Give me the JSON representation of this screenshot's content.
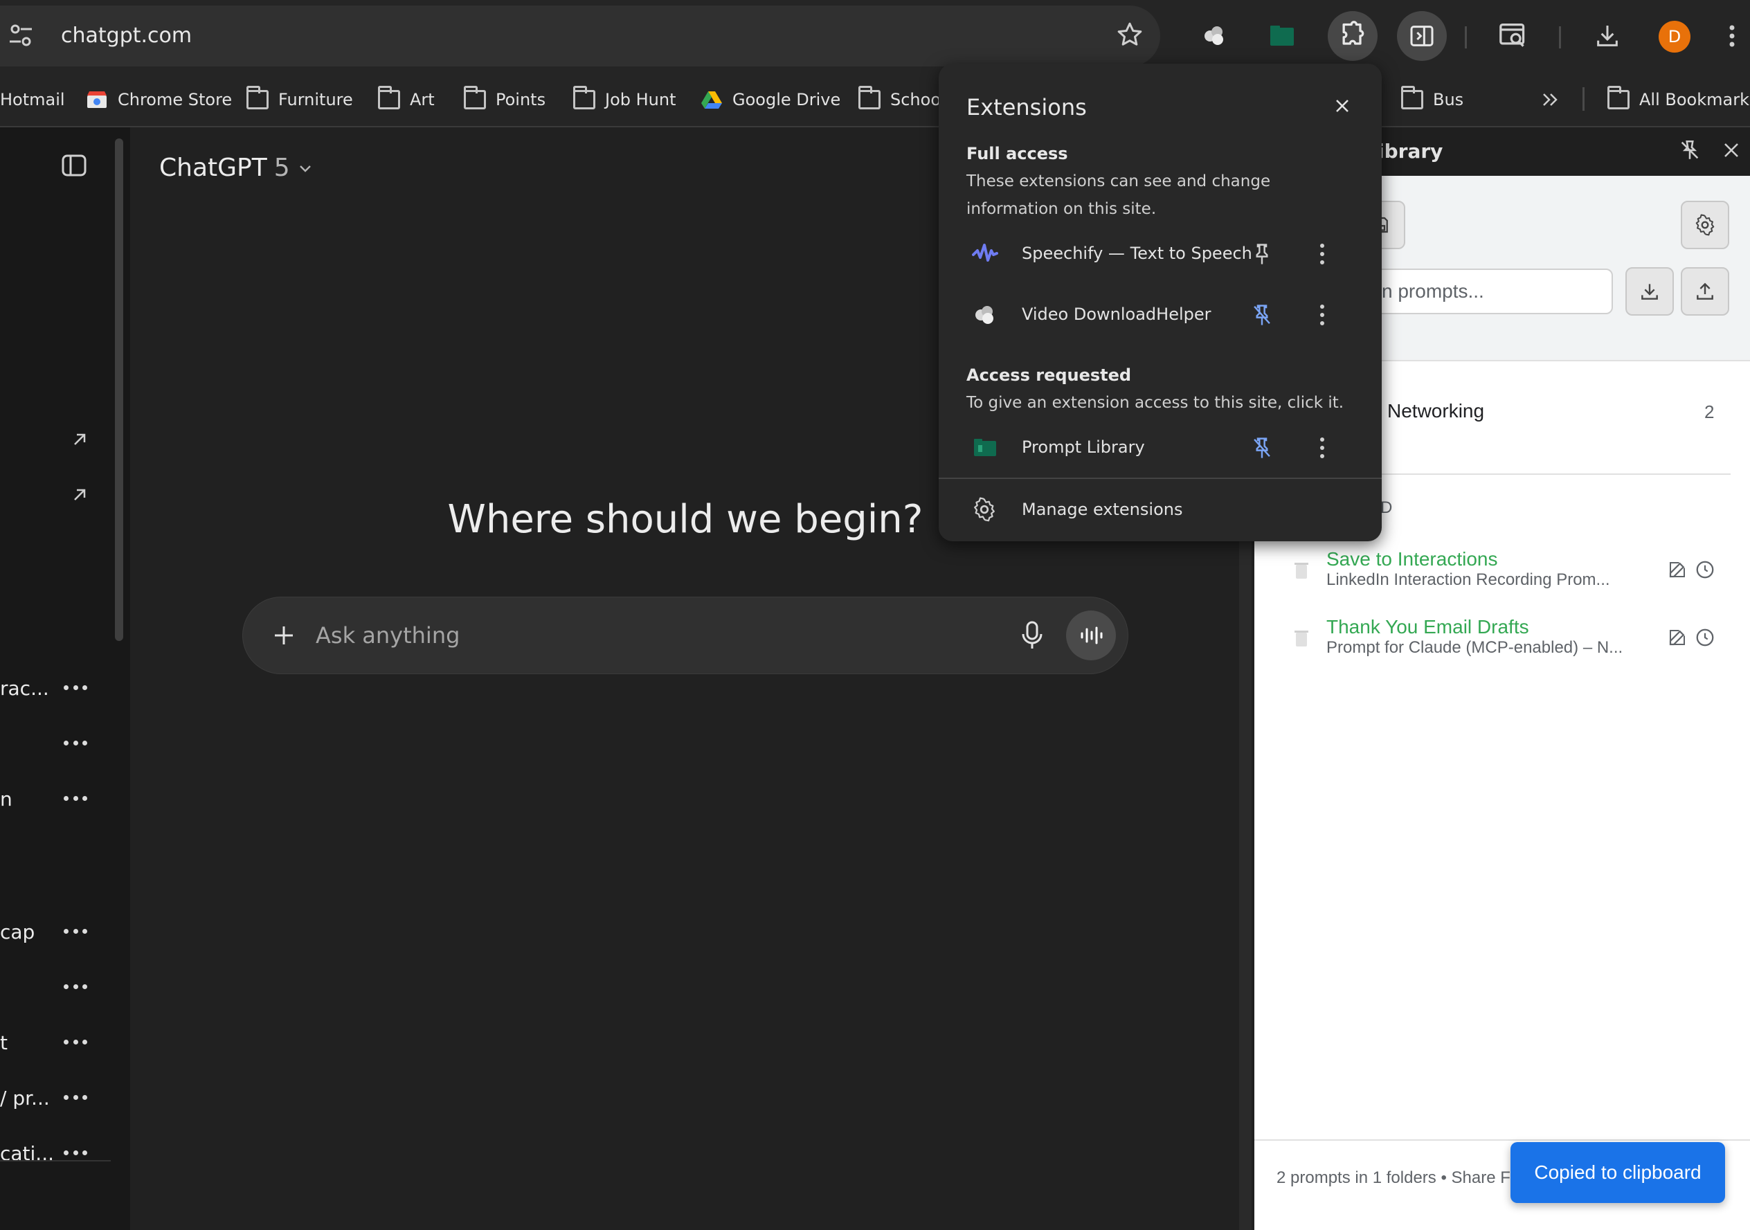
{
  "browser": {
    "url": "chatgpt.com",
    "avatar_letter": "D",
    "bookmarks": [
      {
        "label": "Hotmail",
        "type": "link"
      },
      {
        "label": "Chrome Store",
        "type": "link"
      },
      {
        "label": "Furniture",
        "type": "folder"
      },
      {
        "label": "Art",
        "type": "folder"
      },
      {
        "label": "Points",
        "type": "folder"
      },
      {
        "label": "Job Hunt",
        "type": "folder"
      },
      {
        "label": "Google Drive",
        "type": "link"
      },
      {
        "label": "Schoo",
        "type": "folder"
      },
      {
        "label": "Bus",
        "type": "folder"
      },
      {
        "label": "All Bookmarks",
        "type": "folder"
      }
    ]
  },
  "sidebar": {
    "items": [
      "rac...",
      "",
      "n",
      "cap",
      "",
      "t",
      "/ pr...",
      "cati..."
    ]
  },
  "chat": {
    "model_name": "ChatGPT",
    "model_version": "5",
    "heading": "Where should we begin?",
    "composer_placeholder": "Ask anything"
  },
  "extensions_popup": {
    "title": "Extensions",
    "full_access_heading": "Full access",
    "full_access_desc": "These extensions can see and change information on this site.",
    "full_access_items": [
      "Speechify — Text to Speech",
      "Video DownloadHelper"
    ],
    "access_requested_heading": "Access requested",
    "access_requested_desc": "To give an extension access to this site, click it.",
    "access_requested_items": [
      "Prompt Library"
    ],
    "manage_label": "Manage extensions"
  },
  "side_panel": {
    "title": "ibrary",
    "search_placeholder": "n prompts...",
    "folder": {
      "name": "Networking",
      "count": "2"
    },
    "section_label": "SED",
    "prompts": [
      {
        "title": "Save to Interactions",
        "subtitle": "LinkedIn Interaction Recording Prom..."
      },
      {
        "title": "Thank You Email Drafts",
        "subtitle": "Prompt for Claude (MCP-enabled) – N..."
      }
    ],
    "footer": "2 prompts in 1 folders • Share Fo",
    "toast": "Copied to clipboard"
  },
  "colors": {
    "accent_blue": "#1a73e8",
    "prompt_green": "#34a853",
    "avatar_orange": "#e8710a",
    "page_bg": "#212121"
  }
}
